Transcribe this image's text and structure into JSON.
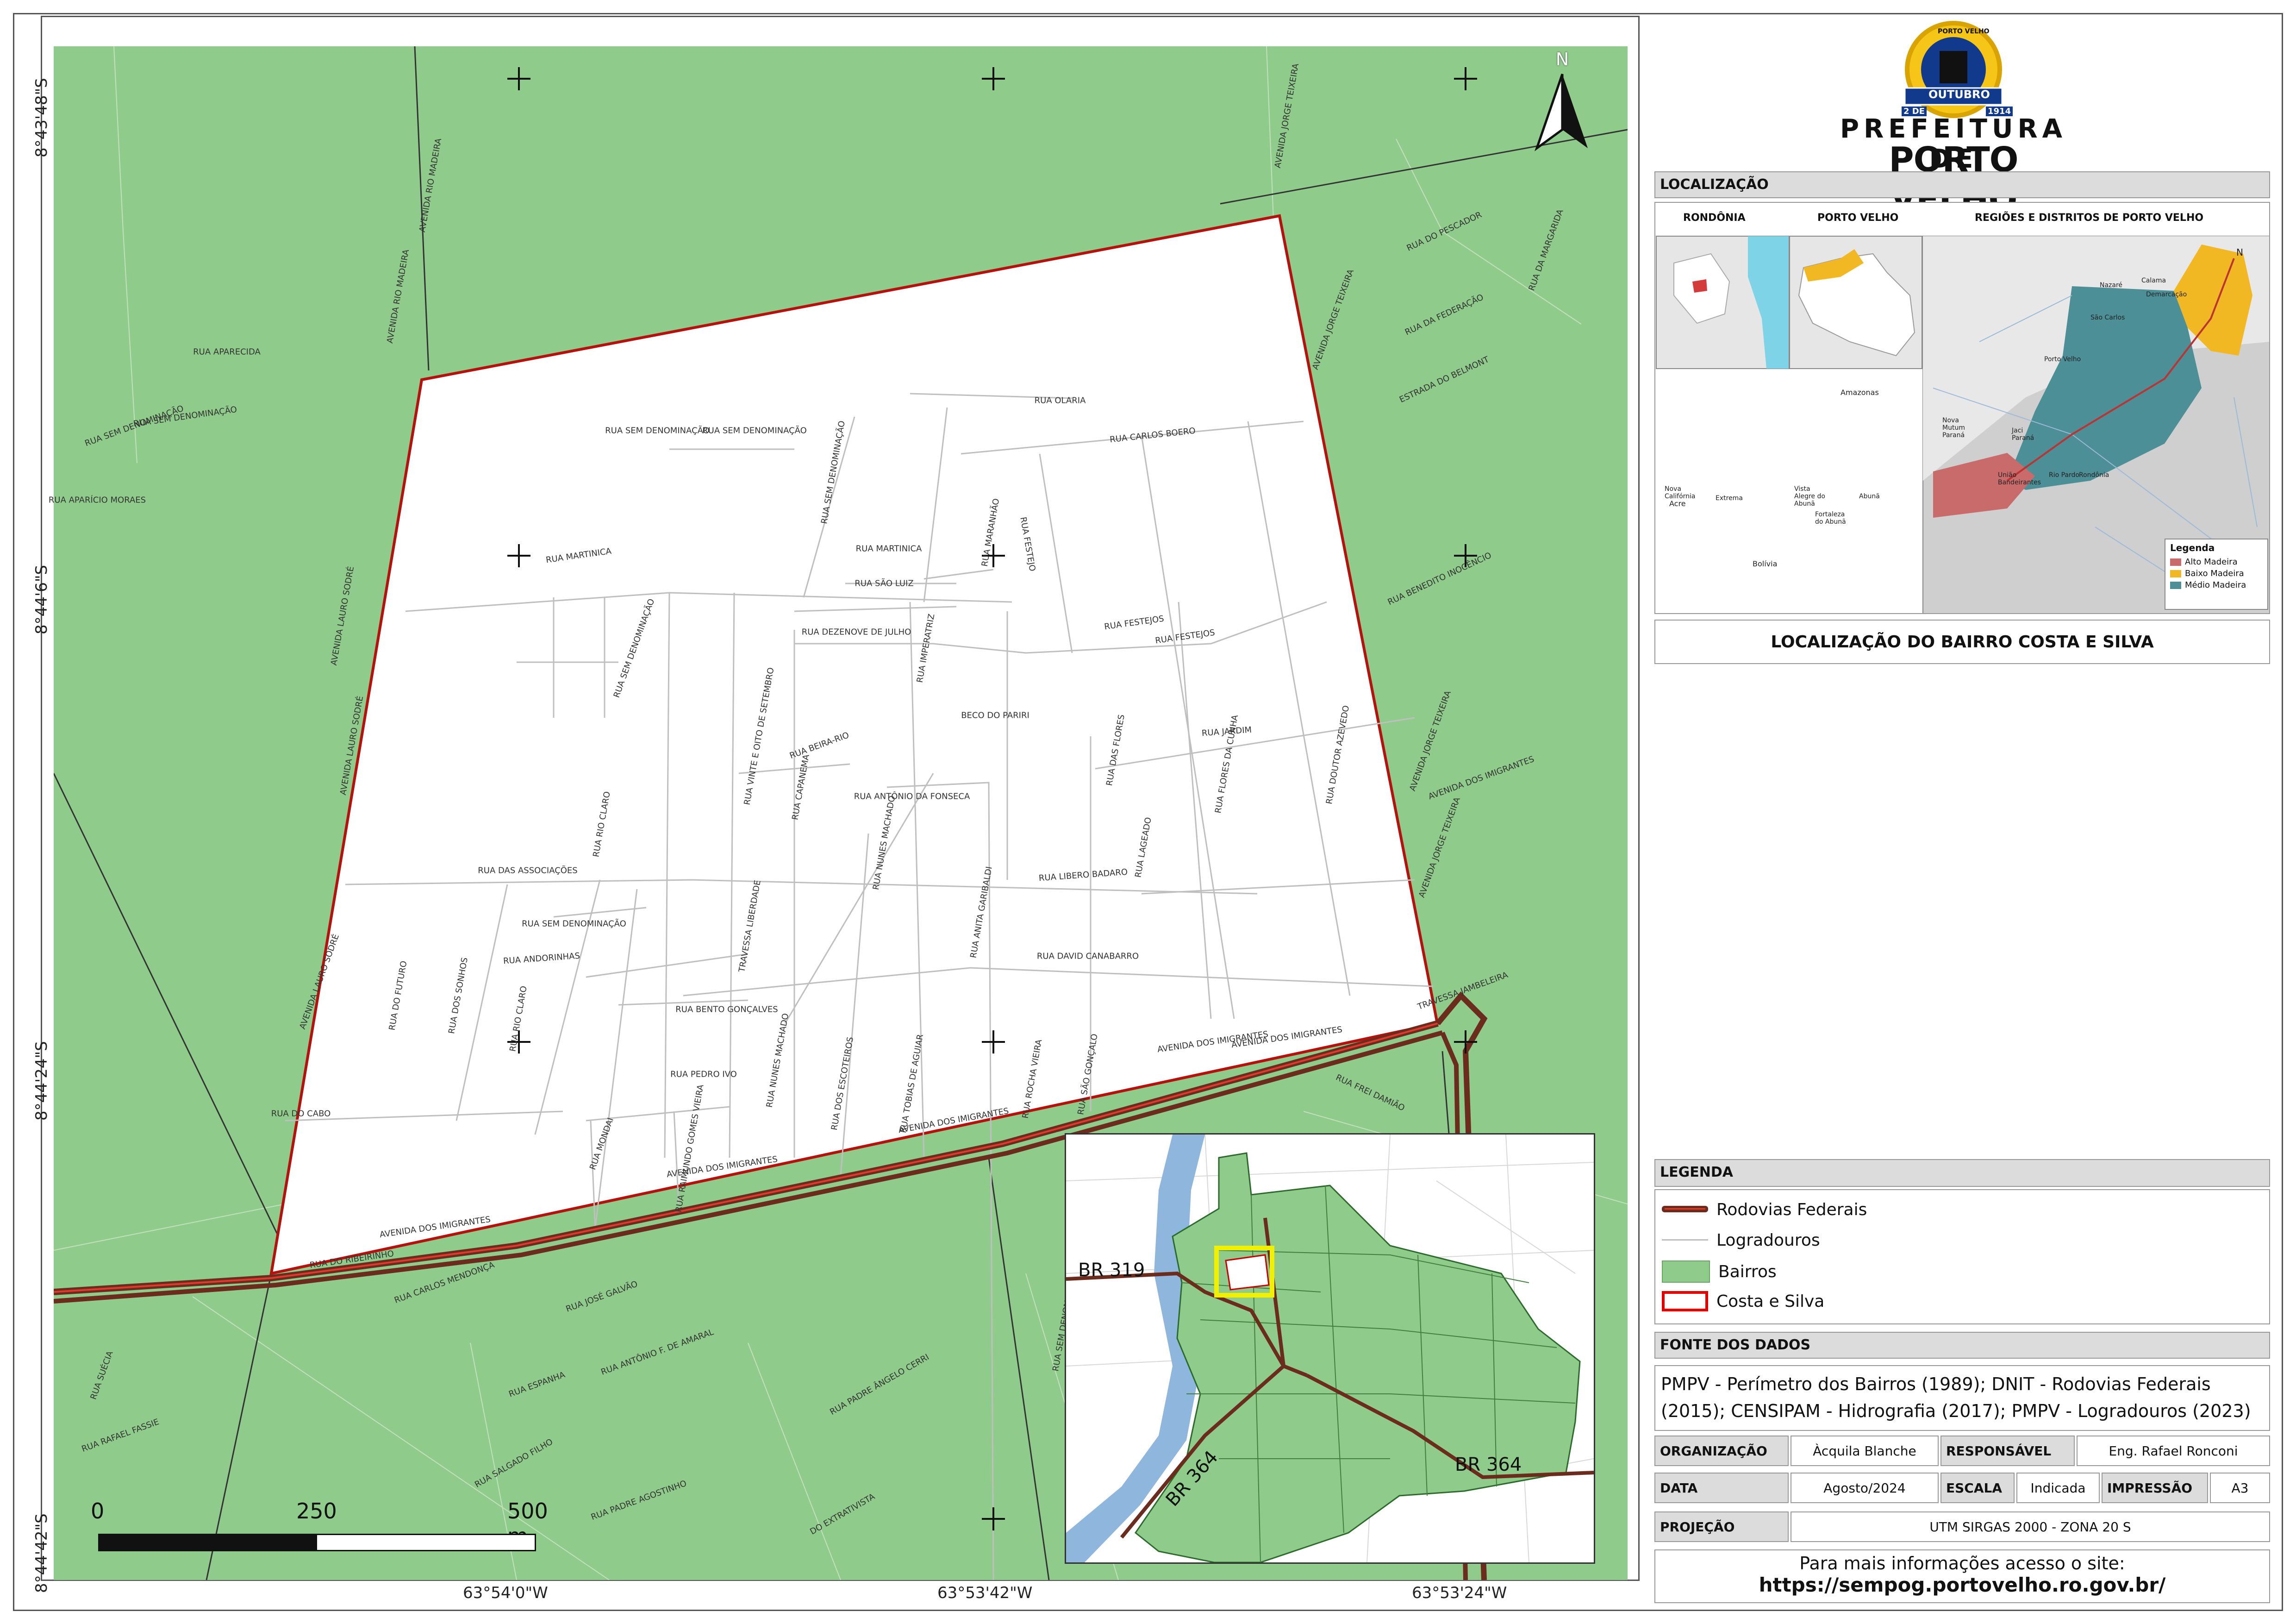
{
  "coords": {
    "lat_top": "8°43'48\"S",
    "lat_1": "8°44'6\"S",
    "lat_2": "8°44'24\"S",
    "lat_bottom": "8°44'42\"S",
    "lon_1": "63°54'0\"W",
    "lon_2": "63°53'42\"W",
    "lon_3": "63°53'24\"W"
  },
  "north": "N",
  "scale": {
    "zero": "0",
    "mid": "250",
    "end": "500 m"
  },
  "inset": {
    "br319": "BR 319",
    "br364a": "BR 364",
    "br364b": "BR 364"
  },
  "logo": {
    "line1": "PREFEITURA DE",
    "line2": "PORTO VELHO",
    "seal_top": "PORTO VELHO",
    "seal_ribbon": "OUTUBRO",
    "seal_left": "2 DE",
    "seal_right": "1914"
  },
  "localizacao": {
    "header": "LOCALIZAÇÃO",
    "col1": "RONDÔNIA",
    "col2": "PORTO VELHO",
    "col3": "REGIÕES E DISTRITOS DE PORTO VELHO",
    "legend_title": "Legenda",
    "legend_items": [
      "Alto Madeira",
      "Baixo Madeira",
      "Médio Madeira"
    ],
    "legend_colors": [
      "#c96b6b",
      "#f2b824",
      "#4c8f96"
    ],
    "places": [
      "Amazonas",
      "Acre",
      "Bolívia",
      "Nova Califórnia",
      "Extrema",
      "Vista Alegre do Abunã",
      "Fortaleza do Abunã",
      "Abunã",
      "Nova Mutum Paraná",
      "Jaci Paraná",
      "União Bandeirantes",
      "Rio Pardo",
      "Rondônia",
      "Nazaré",
      "Calama",
      "Demarcação",
      "São Carlos",
      "Porto Velho",
      "N"
    ],
    "caption": "LOCALIZAÇÃO DO BAIRRO COSTA E SILVA"
  },
  "legenda": {
    "header": "LEGENDA",
    "items": [
      {
        "label": "Rodovias Federais",
        "color": "#6b2c1e"
      },
      {
        "label": "Logradouros",
        "color": "#bdbdbd"
      },
      {
        "label": "Bairros",
        "color": "#8fcb8a"
      },
      {
        "label": "Costa e Silva",
        "color": "#e00000"
      }
    ]
  },
  "fonte": {
    "header": "FONTE DOS DADOS",
    "text": "PMPV - Perímetro dos Bairros (1989); DNIT - Rodovias Federais (2015); CENSIPAM - Hidrografia (2017); PMPV - Logradouros (2023)"
  },
  "meta": {
    "org_label": "ORGANIZAÇÃO",
    "org_value": "Àcquila Blanche",
    "resp_label": "RESPONSÁVEL",
    "resp_value": "Eng. Rafael Ronconi",
    "data_label": "DATA",
    "data_value": "Agosto/2024",
    "escala_label": "ESCALA",
    "escala_value": "Indicada",
    "impressao_label": "IMPRESSÃO",
    "impressao_value": "A3",
    "projecao_label": "PROJEÇÃO",
    "projecao_value": "UTM SIRGAS 2000 - ZONA 20 S"
  },
  "site": {
    "line1": "Para mais informações acesso o site:",
    "line2": "https://sempog.portovelho.ro.gov.br/"
  },
  "streets": [
    {
      "t": "RUA OLARIA"
    },
    {
      "t": "RUA SEM DENOMINAÇÃO"
    },
    {
      "t": "RUA SEM DENOMINAÇÃO"
    },
    {
      "t": "RUA CARLOS BOERO"
    },
    {
      "t": "RUA MARTINICA"
    },
    {
      "t": "RUA MARTINICA"
    },
    {
      "t": "RUA SÃO LUIZ"
    },
    {
      "t": "RUA DEZENOVE DE JULHO"
    },
    {
      "t": "RUA FESTEJOS"
    },
    {
      "t": "RUA FESTEJOS"
    },
    {
      "t": "RUA FESTEJO"
    },
    {
      "t": "BECO DO PARIRI"
    },
    {
      "t": "RUA JARDIM"
    },
    {
      "t": "RUA BEIRA-RIO"
    },
    {
      "t": "RUA ANTÔNIO DA FONSECA"
    },
    {
      "t": "RUA DAS ASSOCIAÇÕES"
    },
    {
      "t": "RUA LIBERO BADARO"
    },
    {
      "t": "RUA SEM DENOMINAÇÃO"
    },
    {
      "t": "RUA ANDORINHAS"
    },
    {
      "t": "RUA DAVID CANABARRO"
    },
    {
      "t": "RUA BENTO GONÇALVES"
    },
    {
      "t": "RUA PEDRO IVO"
    },
    {
      "t": "RUA DO CABO"
    },
    {
      "t": "AVENIDA DOS IMIGRANTES"
    },
    {
      "t": "AVENIDA DOS IMIGRANTES"
    },
    {
      "t": "AVENIDA DOS IMIGRANTES"
    },
    {
      "t": "AVENIDA DOS IMIGRANTES"
    },
    {
      "t": "AVENIDA DOS IMIGRANTES"
    },
    {
      "t": "RUA DO RIBEIRINHO"
    },
    {
      "t": "RUA DO PESCADOR"
    },
    {
      "t": "RUA DA FEDERAÇÃO"
    },
    {
      "t": "ESTRADA DO BELMONT"
    },
    {
      "t": "RUA APARECIDA"
    },
    {
      "t": "RUA SEM DENOMINAÇÃO"
    },
    {
      "t": "RUA SEM DENOMINAÇÃO"
    },
    {
      "t": "RUA APARÍCIO MORAES"
    },
    {
      "t": "RUA BENEDITO INOCÊNCIO"
    },
    {
      "t": "AVENIDA DOS IMIGRANTES"
    },
    {
      "t": "TRAVESSA JAMBELEIRA"
    },
    {
      "t": "RUA FREI DAMIÃO"
    },
    {
      "t": "RUA CARLOS MENDONÇA"
    },
    {
      "t": "RUA JOSÉ GALVÃO"
    },
    {
      "t": "RUA ANTÔNIO F. DE AMARAL"
    },
    {
      "t": "RUA ESPANHA"
    },
    {
      "t": "RUA SUÉCIA"
    },
    {
      "t": "RUA RAFAEL FASSIE"
    },
    {
      "t": "RUA SALGADO FILHO"
    },
    {
      "t": "RUA PADRE AGOSTINHO"
    },
    {
      "t": "RUA PADRE ÂNGELO CERRI"
    },
    {
      "t": "DO EXTRATIVISTA"
    }
  ],
  "vstreets": [
    {
      "t": "RUA SEM DENOMINAÇÃO"
    },
    {
      "t": "RUA SEM DENOMINAÇÃO"
    },
    {
      "t": "RUA MARANHÃO"
    },
    {
      "t": "RUA IMPERATRIZ"
    },
    {
      "t": "RUA VINTE E OITO DE SETEMBRO"
    },
    {
      "t": "RUA CAPANEMA"
    },
    {
      "t": "RUA RIO CLARO"
    },
    {
      "t": "RUA NUNES MACHADO"
    },
    {
      "t": "RUA DAS FLORES"
    },
    {
      "t": "RUA FLORES DA CUNHA"
    },
    {
      "t": "RUA DOUTOR AZEVEDO"
    },
    {
      "t": "RUA LAGEADO"
    },
    {
      "t": "RUA ANITA GARIBALDI"
    },
    {
      "t": "TRAVESSA LIBERDADE"
    },
    {
      "t": "RUA DO FUTURO"
    },
    {
      "t": "RUA DOS SONHOS"
    },
    {
      "t": "RUA RIO CLARO"
    },
    {
      "t": "RUA NUNES MACHADO"
    },
    {
      "t": "RUA DOS ESCOTEIROS"
    },
    {
      "t": "RUA TOBIAS DE AGUIAR"
    },
    {
      "t": "RUA ROCHA VIEIRA"
    },
    {
      "t": "RUA SÃO GONÇALO"
    },
    {
      "t": "RUA RAIMUNDO GOMES VIEIRA"
    },
    {
      "t": "RUA MONDAI"
    },
    {
      "t": "AVENIDA JORGE TEIXEIRA"
    },
    {
      "t": "AVENIDA JORGE TEIXEIRA"
    },
    {
      "t": "AVENIDA JORGE TEIXEIRA"
    },
    {
      "t": "AVENIDA JORGE TEIXEIRA"
    },
    {
      "t": "AVENIDA RIO MADEIRA"
    },
    {
      "t": "AVENIDA RIO MADEIRA"
    },
    {
      "t": "AVENIDA LAURO SODRÉ"
    },
    {
      "t": "AVENIDA LAURO SODRÉ"
    },
    {
      "t": "AVENIDA LAURO SODRÉ"
    },
    {
      "t": "RUA DA MARGARIDA"
    },
    {
      "t": "RUA SEM DENOMINAÇÃO"
    }
  ]
}
